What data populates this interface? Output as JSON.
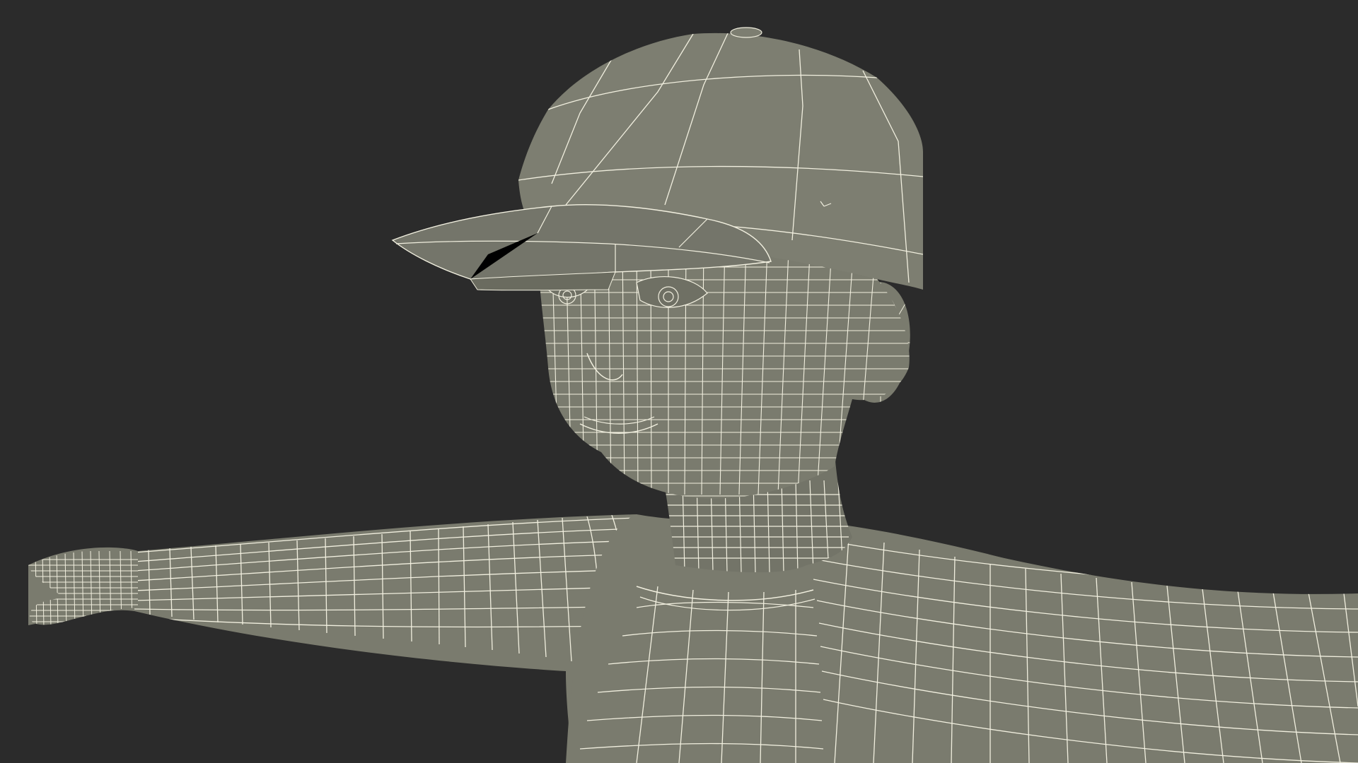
{
  "render": {
    "subject": "wireframe-character-bust",
    "background_color": "#2b2b2b",
    "surface_color": "#7a7b6e",
    "surface_shadow_color": "#6a6b5f",
    "wire_color": "#f1efdf"
  }
}
